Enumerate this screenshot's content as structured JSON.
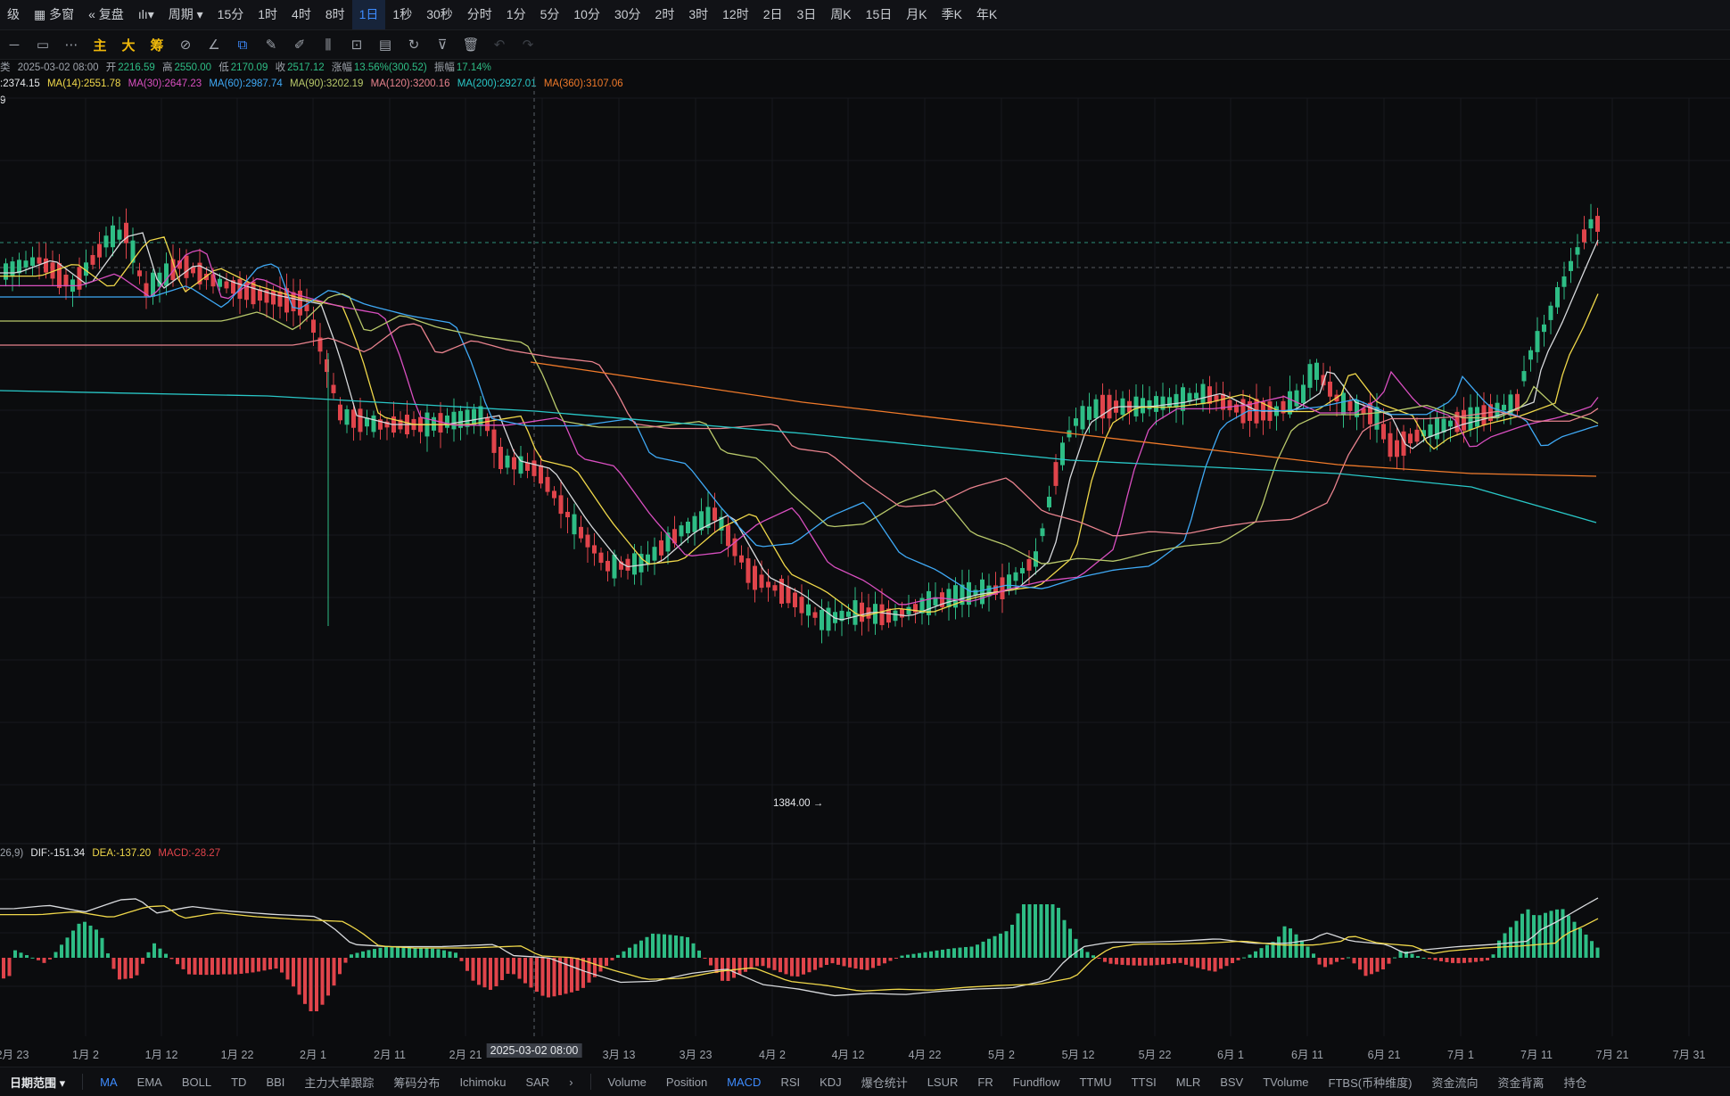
{
  "topbar": {
    "items": [
      "级",
      "多窗",
      "复盘",
      "周期",
      "15分",
      "1时",
      "4时",
      "8时",
      "1日",
      "1秒",
      "30秒",
      "分时",
      "1分",
      "5分",
      "10分",
      "30分",
      "2时",
      "3时",
      "12时",
      "2日",
      "3日",
      "周K",
      "15日",
      "月K",
      "季K",
      "年K"
    ],
    "active": "1日"
  },
  "toolbar": {
    "main_label": "主",
    "big_label": "大",
    "chip_label": "筹"
  },
  "ohlc_line": {
    "prefix": "类",
    "date": "2025-03-02 08:00",
    "open_label": "开",
    "open": "2216.59",
    "high_label": "高",
    "high": "2550.00",
    "low_label": "低",
    "low": "2170.09",
    "close_label": "收",
    "close": "2517.12",
    "change_label": "涨幅",
    "change": "13.56%(300.52)",
    "amplitude_label": "振幅",
    "amplitude": "17.14%"
  },
  "ma_line": {
    "first": ":2374.15",
    "items": [
      {
        "label": "MA(14):2551.78",
        "color": "#f0d84a"
      },
      {
        "label": "MA(30):2647.23",
        "color": "#d94fc0"
      },
      {
        "label": "MA(60):2987.74",
        "color": "#3fa9f5"
      },
      {
        "label": "MA(90):3202.19",
        "color": "#b9c96b"
      },
      {
        "label": "MA(120):3200.16",
        "color": "#e7828d"
      },
      {
        "label": "MA(200):2927.01",
        "color": "#29c7c7"
      },
      {
        "label": "MA(360):3107.06",
        "color": "#f07a2a"
      }
    ],
    "second_line": "9"
  },
  "low_marker": "1384.00 →",
  "macd_line": {
    "prefix": "26,9)",
    "dif": "DIF:-151.34",
    "dea": "DEA:-137.20",
    "macd": "MACD:-28.27"
  },
  "xaxis": {
    "labels": [
      "2月 23",
      "1月 2",
      "1月 12",
      "1月 22",
      "2月 1",
      "2月 11",
      "2月 21",
      "3月 13",
      "3月 23",
      "4月 2",
      "4月 12",
      "4月 22",
      "5月 2",
      "5月 12",
      "5月 22",
      "6月 1",
      "6月 11",
      "6月 21",
      "7月 1",
      "7月 11",
      "7月 21",
      "7月 31"
    ],
    "crosshair": "2025-03-02 08:00"
  },
  "bottombar": {
    "range_label": "日期范围",
    "indicators": [
      "MA",
      "EMA",
      "BOLL",
      "TD",
      "BBI",
      "主力大单跟踪",
      "筹码分布",
      "Ichimoku",
      "SAR"
    ],
    "sub_indicators": [
      "Volume",
      "Position",
      "MACD",
      "RSI",
      "KDJ",
      "爆仓统计",
      "LSUR",
      "FR",
      "Fundflow",
      "TTMU",
      "TTSI",
      "MLR",
      "BSV",
      "TVolume",
      "FTBS(币种维度)",
      "资金流向",
      "资金背离",
      "持仓"
    ],
    "active_main": "MA",
    "active_sub": "MACD"
  },
  "colors": {
    "up": "#2ebd85",
    "down": "#e0444b",
    "bg": "#0b0c0e"
  }
}
